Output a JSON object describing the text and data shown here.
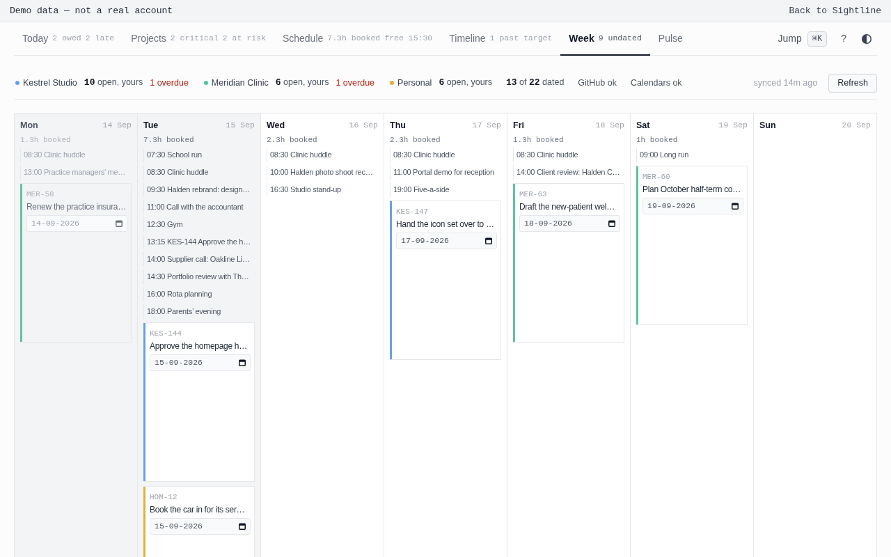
{
  "banner": {
    "notice": "Demo data — not a real account",
    "back_link": "Back to Sightline"
  },
  "tabs": [
    {
      "label": "Today",
      "stats": [
        "2 owed",
        "2 late"
      ],
      "selected": false
    },
    {
      "label": "Projects",
      "stats": [
        "2 critical",
        "2 at risk"
      ],
      "selected": false
    },
    {
      "label": "Schedule",
      "stats": [
        "7.3h booked",
        "free 15:30"
      ],
      "selected": false
    },
    {
      "label": "Timeline",
      "stats": [
        "1 past target"
      ],
      "selected": false
    },
    {
      "label": "Week",
      "stats": [
        "9 undated"
      ],
      "selected": true
    },
    {
      "label": "Pulse",
      "selected": false
    }
  ],
  "nav_actions": {
    "jump": "Jump",
    "shortcut": "⌘K",
    "help": "?"
  },
  "summary": {
    "workspaces": [
      {
        "name": "Kestrel Studio",
        "color": "#64a0f0",
        "open": "**10** open, yours",
        "overdue": "1 overdue"
      },
      {
        "name": "Meridian Clinic",
        "color": "#4fc79a",
        "open": "**6** open, yours",
        "overdue": "1 overdue"
      },
      {
        "name": "Personal",
        "color": "#e3ad3b",
        "open": "**6** open, yours"
      }
    ],
    "dated": "**13** of **22** dated",
    "integrations": [
      "GitHub ok",
      "Calendars ok"
    ],
    "synced": "synced 14m ago",
    "refresh": "Refresh"
  },
  "days": [
    {
      "day": "Mon",
      "date": "14 Sep",
      "booked": "1.3h booked",
      "past": true,
      "today": false,
      "events": [
        "08:30 Clinic huddle",
        "13:00 Practice managers’ me…"
      ],
      "tasks": [
        {
          "id": "MER-58",
          "title": "Renew the practice insura…",
          "due": "14-09-2026",
          "color": "#5cc59c"
        }
      ]
    },
    {
      "day": "Tue",
      "date": "15 Sep",
      "booked": "7.3h booked",
      "past": false,
      "today": true,
      "events": [
        "07:30 School run",
        "08:30 Clinic huddle",
        "09:30 Halden rebrand: design…",
        "11:00 Call with the accountant",
        "12:30 Gym",
        "13:15 KES-144 Approve the h…",
        "14:00 Supplier call: Oakline Li…",
        "14:30 Portfolio review with Th…",
        "16:00 Rota planning",
        "18:00 Parents’ evening"
      ],
      "tasks": [
        {
          "id": "KES-144",
          "title": "Approve the homepage h…",
          "due": "15-09-2026",
          "color": "#6a9fe8"
        },
        {
          "id": "HOM-12",
          "title": "Book the car in for its ser…",
          "due": "15-09-2026",
          "color": "#e0b040"
        }
      ]
    },
    {
      "day": "Wed",
      "date": "16 Sep",
      "booked": "2.3h booked",
      "past": false,
      "today": false,
      "events": [
        "08:30 Clinic huddle",
        "10:00 Halden photo shoot rec…",
        "16:30 Studio stand-up"
      ]
    },
    {
      "day": "Thu",
      "date": "17 Sep",
      "booked": "2.3h booked",
      "past": false,
      "today": false,
      "events": [
        "08:30 Clinic huddle",
        "11:00 Portal demo for reception",
        "19:00 Five-a-side"
      ],
      "tasks": [
        {
          "id": "KES-147",
          "title": "Hand the icon set over to …",
          "due": "17-09-2026",
          "color": "#6a9fe8"
        }
      ]
    },
    {
      "day": "Fri",
      "date": "18 Sep",
      "booked": "1.3h booked",
      "past": false,
      "today": false,
      "events": [
        "08:30 Clinic huddle",
        "14:00 Client review: Halden C…"
      ],
      "tasks": [
        {
          "id": "MER-63",
          "title": "Draft the new-patient wel…",
          "due": "18-09-2026",
          "color": "#5cc59c"
        }
      ]
    },
    {
      "day": "Sat",
      "date": "19 Sep",
      "booked": "1h booked",
      "past": false,
      "today": false,
      "events": [
        "09:00 Long run"
      ],
      "tasks": [
        {
          "id": "MER-60",
          "title": "Plan October half-term co…",
          "due": "19-09-2026",
          "color": "#5cc59c"
        }
      ]
    },
    {
      "day": "Sun",
      "date": "20 Sep",
      "past": false,
      "today": false
    }
  ]
}
